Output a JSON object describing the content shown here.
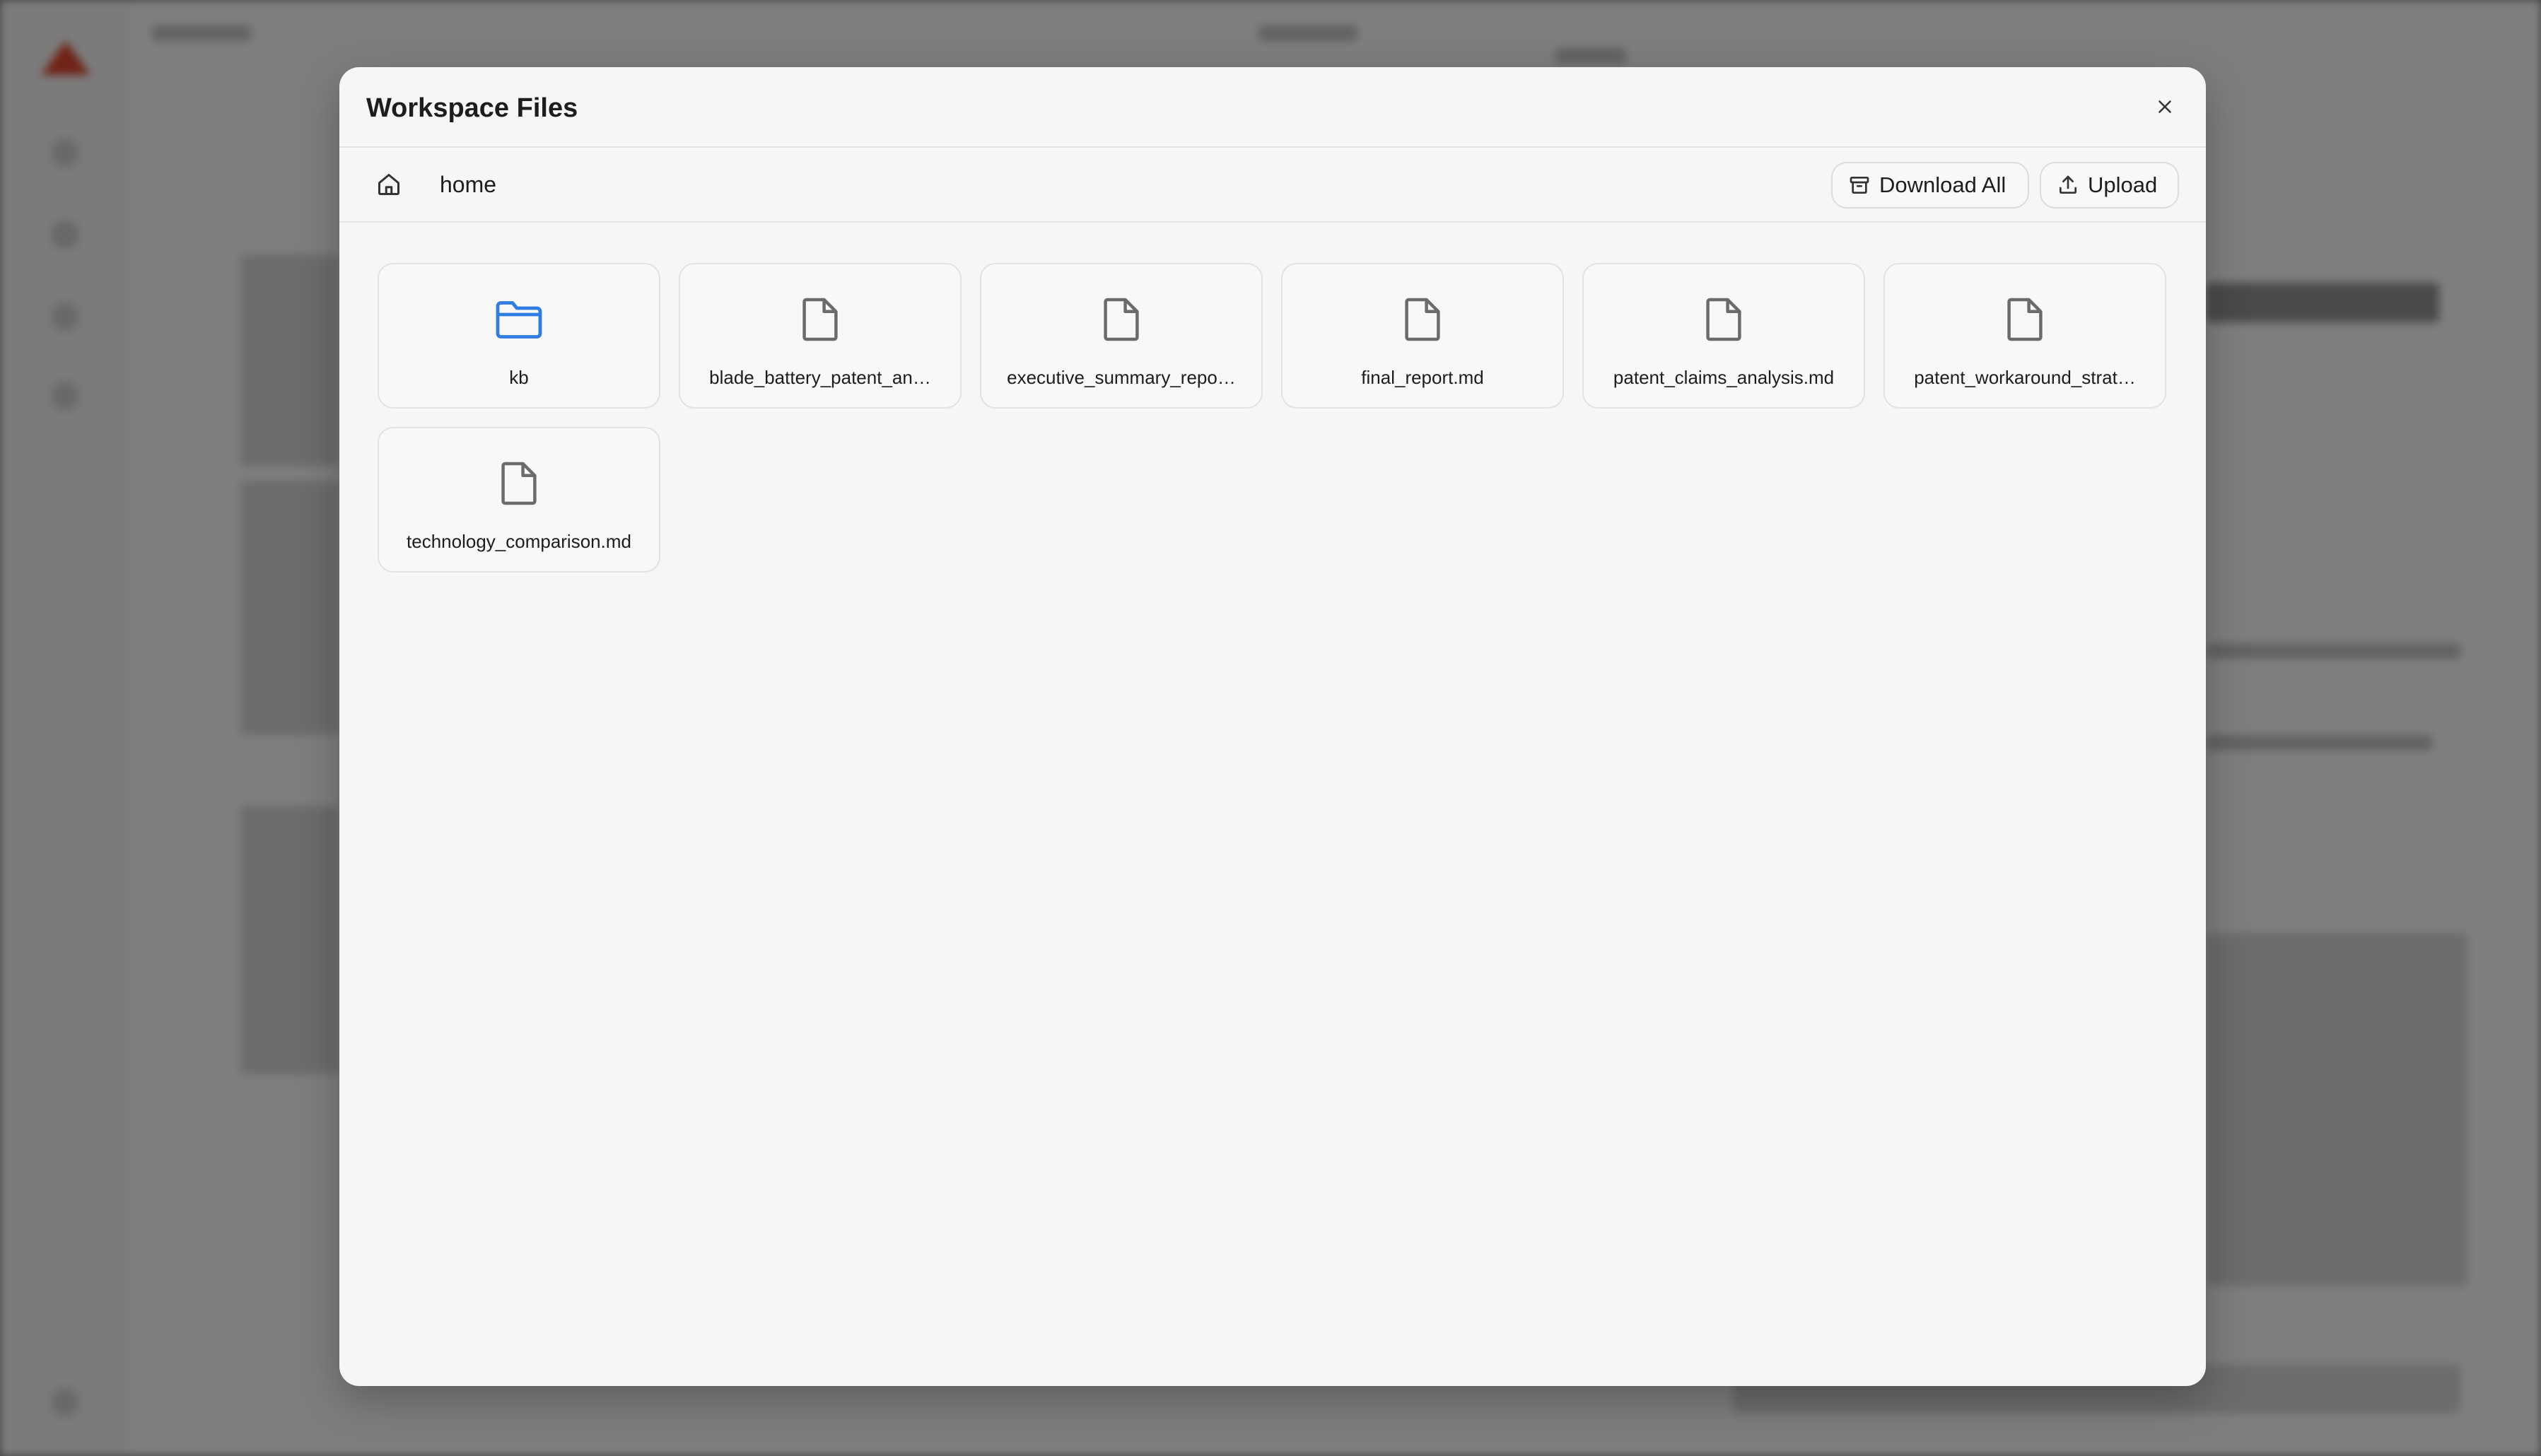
{
  "modal": {
    "title": "Workspace Files"
  },
  "toolbar": {
    "breadcrumb": "home",
    "download_all_label": "Download All",
    "upload_label": "Upload"
  },
  "files": [
    {
      "name": "kb",
      "type": "folder",
      "icon": "folder-icon"
    },
    {
      "name": "blade_battery_patent_an…",
      "type": "file",
      "icon": "file-icon"
    },
    {
      "name": "executive_summary_repo…",
      "type": "file",
      "icon": "file-icon"
    },
    {
      "name": "final_report.md",
      "type": "file",
      "icon": "file-icon"
    },
    {
      "name": "patent_claims_analysis.md",
      "type": "file",
      "icon": "file-icon"
    },
    {
      "name": "patent_workaround_strat…",
      "type": "file",
      "icon": "file-icon"
    },
    {
      "name": "technology_comparison.md",
      "type": "file",
      "icon": "file-icon"
    }
  ],
  "colors": {
    "folder": "#2f7de1",
    "file_icon": "#6b6b6b",
    "modal_bg": "#f6f6f6",
    "text": "#1d1d1d"
  }
}
